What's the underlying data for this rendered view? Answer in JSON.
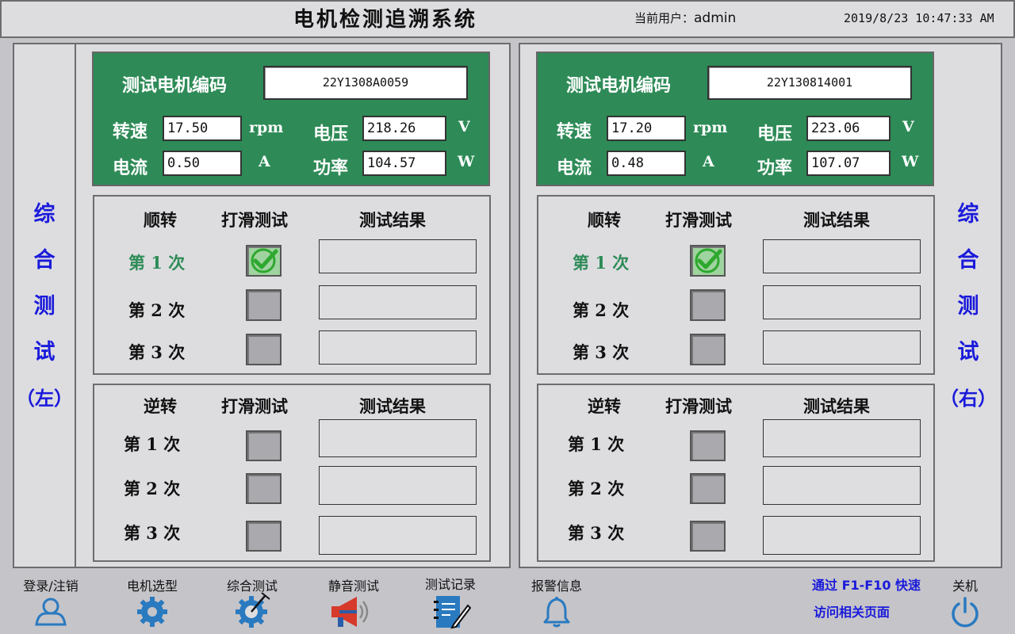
{
  "header": {
    "title": "电机检测追溯系统",
    "user_label": "当前用户：",
    "user_name": "admin",
    "datetime": "2019/8/23 10:47:33 AM"
  },
  "left_panel": {
    "side_title": [
      "综",
      "合",
      "测",
      "试",
      "（左）"
    ],
    "code_label": "测试电机编码",
    "code_value": "22Y1308A0059",
    "speed_label": "转速",
    "speed_value": "17.50",
    "speed_unit": "rpm",
    "voltage_label": "电压",
    "voltage_value": "218.26",
    "voltage_unit": "V",
    "current_label": "电流",
    "current_value": "0.50",
    "current_unit": "A",
    "power_label": "功率",
    "power_value": "104.57",
    "power_unit": "W",
    "forward": {
      "header": [
        "顺转",
        "打滑测试",
        "测试结果"
      ],
      "rows": [
        {
          "label": "第 1 次",
          "checked": true,
          "result": ""
        },
        {
          "label": "第 2 次",
          "checked": false,
          "result": ""
        },
        {
          "label": "第 3 次",
          "checked": false,
          "result": ""
        }
      ]
    },
    "reverse": {
      "header": [
        "逆转",
        "打滑测试",
        "测试结果"
      ],
      "rows": [
        {
          "label": "第 1 次",
          "checked": false,
          "result": ""
        },
        {
          "label": "第 2 次",
          "checked": false,
          "result": ""
        },
        {
          "label": "第 3 次",
          "checked": false,
          "result": ""
        }
      ]
    }
  },
  "right_panel": {
    "side_title": [
      "综",
      "合",
      "测",
      "试",
      "（右）"
    ],
    "code_label": "测试电机编码",
    "code_value": "22Y130814001",
    "speed_label": "转速",
    "speed_value": "17.20",
    "speed_unit": "rpm",
    "voltage_label": "电压",
    "voltage_value": "223.06",
    "voltage_unit": "V",
    "current_label": "电流",
    "current_value": "0.48",
    "current_unit": "A",
    "power_label": "功率",
    "power_value": "107.07",
    "power_unit": "W",
    "forward": {
      "header": [
        "顺转",
        "打滑测试",
        "测试结果"
      ],
      "rows": [
        {
          "label": "第 1 次",
          "checked": true,
          "result": ""
        },
        {
          "label": "第 2 次",
          "checked": false,
          "result": ""
        },
        {
          "label": "第 3 次",
          "checked": false,
          "result": ""
        }
      ]
    },
    "reverse": {
      "header": [
        "逆转",
        "打滑测试",
        "测试结果"
      ],
      "rows": [
        {
          "label": "第 1 次",
          "checked": false,
          "result": ""
        },
        {
          "label": "第 2 次",
          "checked": false,
          "result": ""
        },
        {
          "label": "第 3 次",
          "checked": false,
          "result": ""
        }
      ]
    }
  },
  "bottom_nav": {
    "items": [
      {
        "label": "登录/注销",
        "icon": "user-icon"
      },
      {
        "label": "电机选型",
        "icon": "gear-icon"
      },
      {
        "label": "综合测试",
        "icon": "gauge-gear-icon"
      },
      {
        "label": "静音测试",
        "icon": "megaphone-icon"
      },
      {
        "label": "测试记录",
        "icon": "notebook-icon"
      },
      {
        "label": "报警信息",
        "icon": "bell-icon"
      }
    ],
    "hint_line1": "通过 F1-F10 快速",
    "hint_line2": "访问相关页面",
    "power_label": "关机",
    "power_icon": "power-icon"
  },
  "colors": {
    "accent_blue": "#1a1adb",
    "info_green": "#2e8b57",
    "icon_blue": "#2a7ac0",
    "check_green": "#2ea82e"
  }
}
